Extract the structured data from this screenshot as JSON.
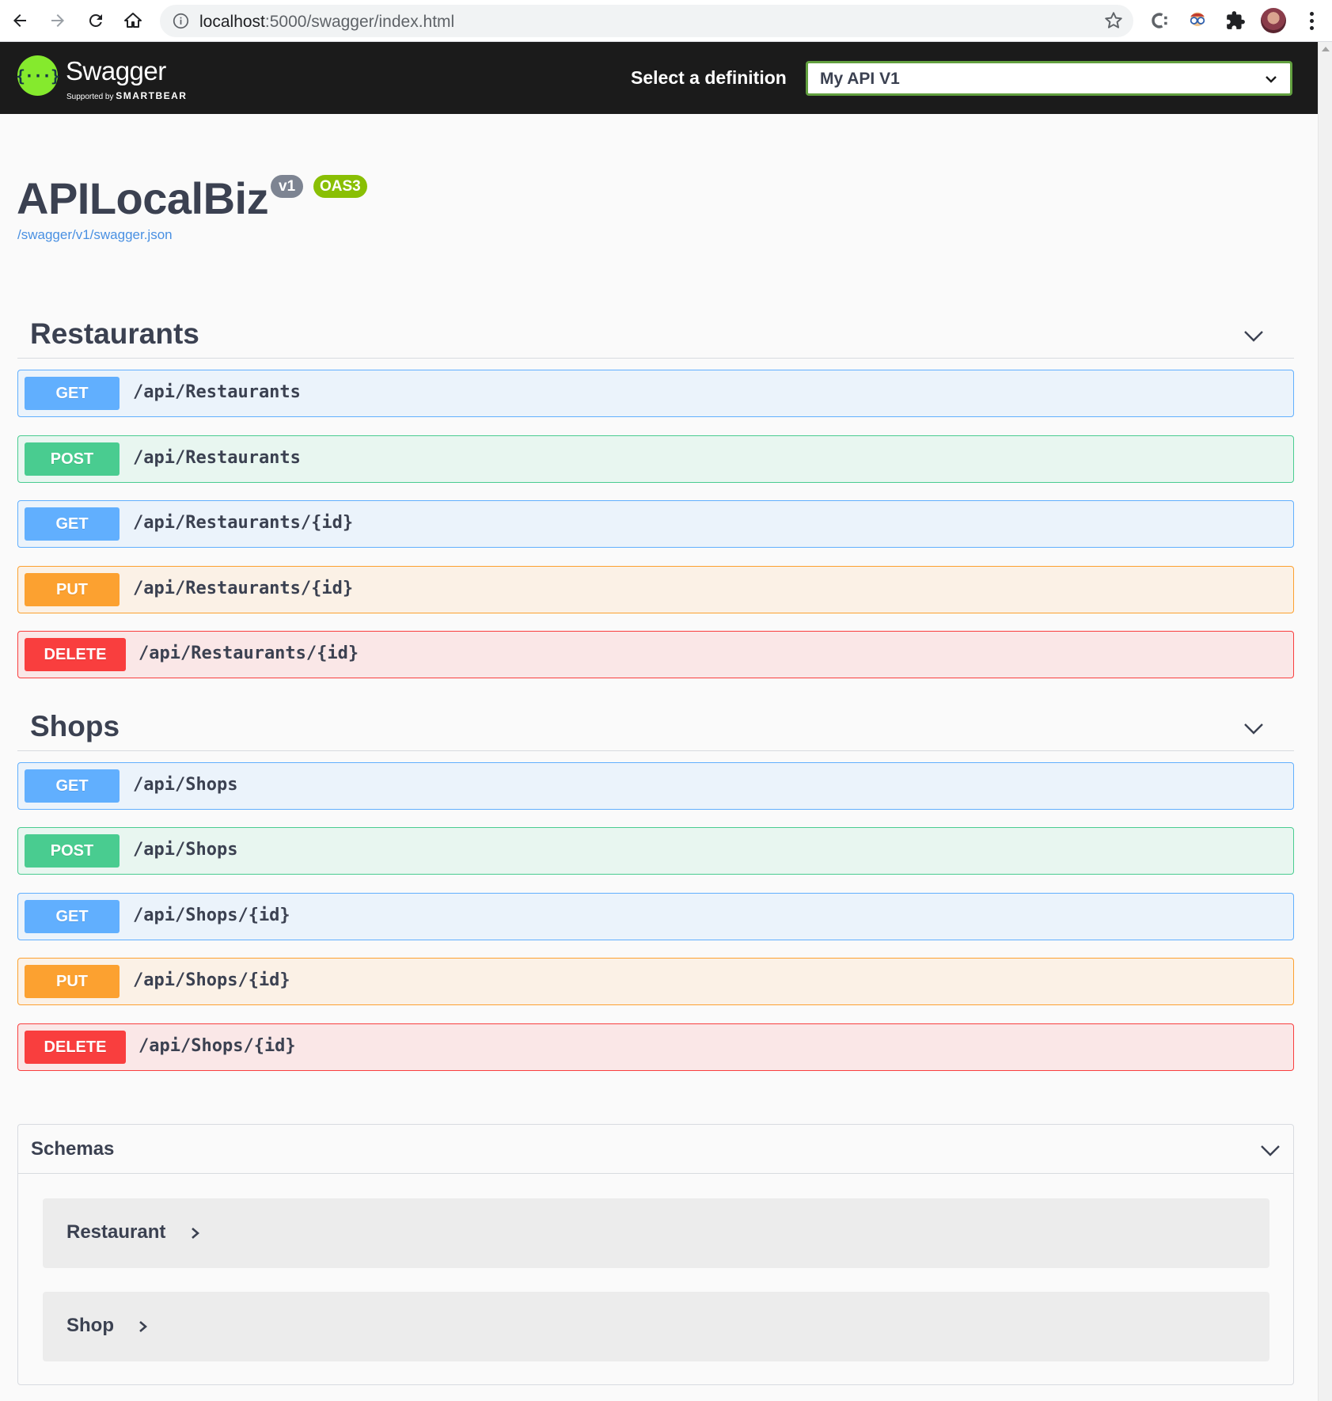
{
  "browser": {
    "url_host": "localhost",
    "url_rest": ":5000/swagger/index.html"
  },
  "topbar": {
    "logo_text": "Swagger",
    "logo_mark": "{···}",
    "supported_by": "Supported by",
    "smartbear": "SMARTBEAR",
    "definition_label": "Select a definition",
    "definition_value": "My API V1",
    "accent_color": "#85ea2d"
  },
  "info": {
    "title": "APILocalBiz",
    "version_badge": "v1",
    "oas_badge": "OAS3",
    "spec_link": "/swagger/v1/swagger.json"
  },
  "tags": [
    {
      "name": "Restaurants",
      "operations": [
        {
          "method": "GET",
          "path": "/api/Restaurants"
        },
        {
          "method": "POST",
          "path": "/api/Restaurants"
        },
        {
          "method": "GET",
          "path": "/api/Restaurants/{id}"
        },
        {
          "method": "PUT",
          "path": "/api/Restaurants/{id}"
        },
        {
          "method": "DELETE",
          "path": "/api/Restaurants/{id}"
        }
      ]
    },
    {
      "name": "Shops",
      "operations": [
        {
          "method": "GET",
          "path": "/api/Shops"
        },
        {
          "method": "POST",
          "path": "/api/Shops"
        },
        {
          "method": "GET",
          "path": "/api/Shops/{id}"
        },
        {
          "method": "PUT",
          "path": "/api/Shops/{id}"
        },
        {
          "method": "DELETE",
          "path": "/api/Shops/{id}"
        }
      ]
    }
  ],
  "schemas": {
    "title": "Schemas",
    "models": [
      "Restaurant",
      "Shop"
    ]
  },
  "method_colors": {
    "GET": "#61affe",
    "POST": "#49cc90",
    "PUT": "#fca130",
    "DELETE": "#f93e3e"
  }
}
